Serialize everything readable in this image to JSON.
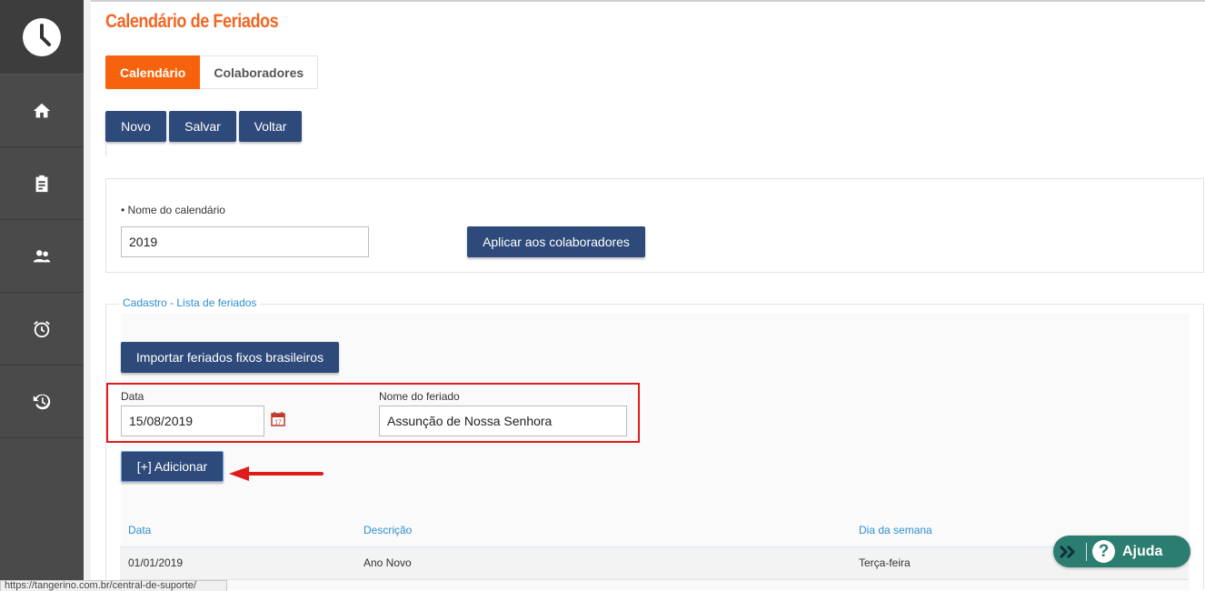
{
  "page": {
    "title": "Calendário de Feriados"
  },
  "tabs": [
    {
      "label": "Calendário"
    },
    {
      "label": "Colaboradores"
    }
  ],
  "toolbar": {
    "new_label": "Novo",
    "save_label": "Salvar",
    "back_label": "Voltar"
  },
  "calendar_form": {
    "name_label": "• Nome do calendário",
    "name_value": "2019",
    "apply_button": "Aplicar aos colaboradores"
  },
  "holidays": {
    "legend": "Cadastro - Lista de feriados",
    "import_button": "Importar feriados fixos brasileiros",
    "date_label": "Data",
    "date_value": "15/08/2019",
    "name_label": "Nome do feriado",
    "name_value": "Assunção de Nossa Senhora",
    "add_button": "[+] Adicionar"
  },
  "table": {
    "headers": [
      "Data",
      "Descrição",
      "Dia da semana"
    ],
    "rows": [
      [
        "01/01/2019",
        "Ano Novo",
        "Terça-feira"
      ]
    ]
  },
  "help": {
    "label": "Ajuda"
  },
  "status": {
    "url": "https://tangerino.com.br/central-de-suporte/"
  },
  "colors": {
    "accent": "#f7630c",
    "primary_button": "#2e4a7a",
    "sidebar": "#4a4a4a",
    "highlight": "#e11b1b",
    "help": "#2b7d70",
    "link": "#2e8fd0"
  },
  "icons": {
    "logo": "clock-icon",
    "nav": [
      "home-icon",
      "clipboard-icon",
      "people-icon",
      "alarm-icon",
      "history-icon"
    ],
    "date_picker": "calendar-icon",
    "help_chevron": "double-chevron-right-icon",
    "help_question": "question-icon",
    "annotation": "red-arrow-icon"
  }
}
